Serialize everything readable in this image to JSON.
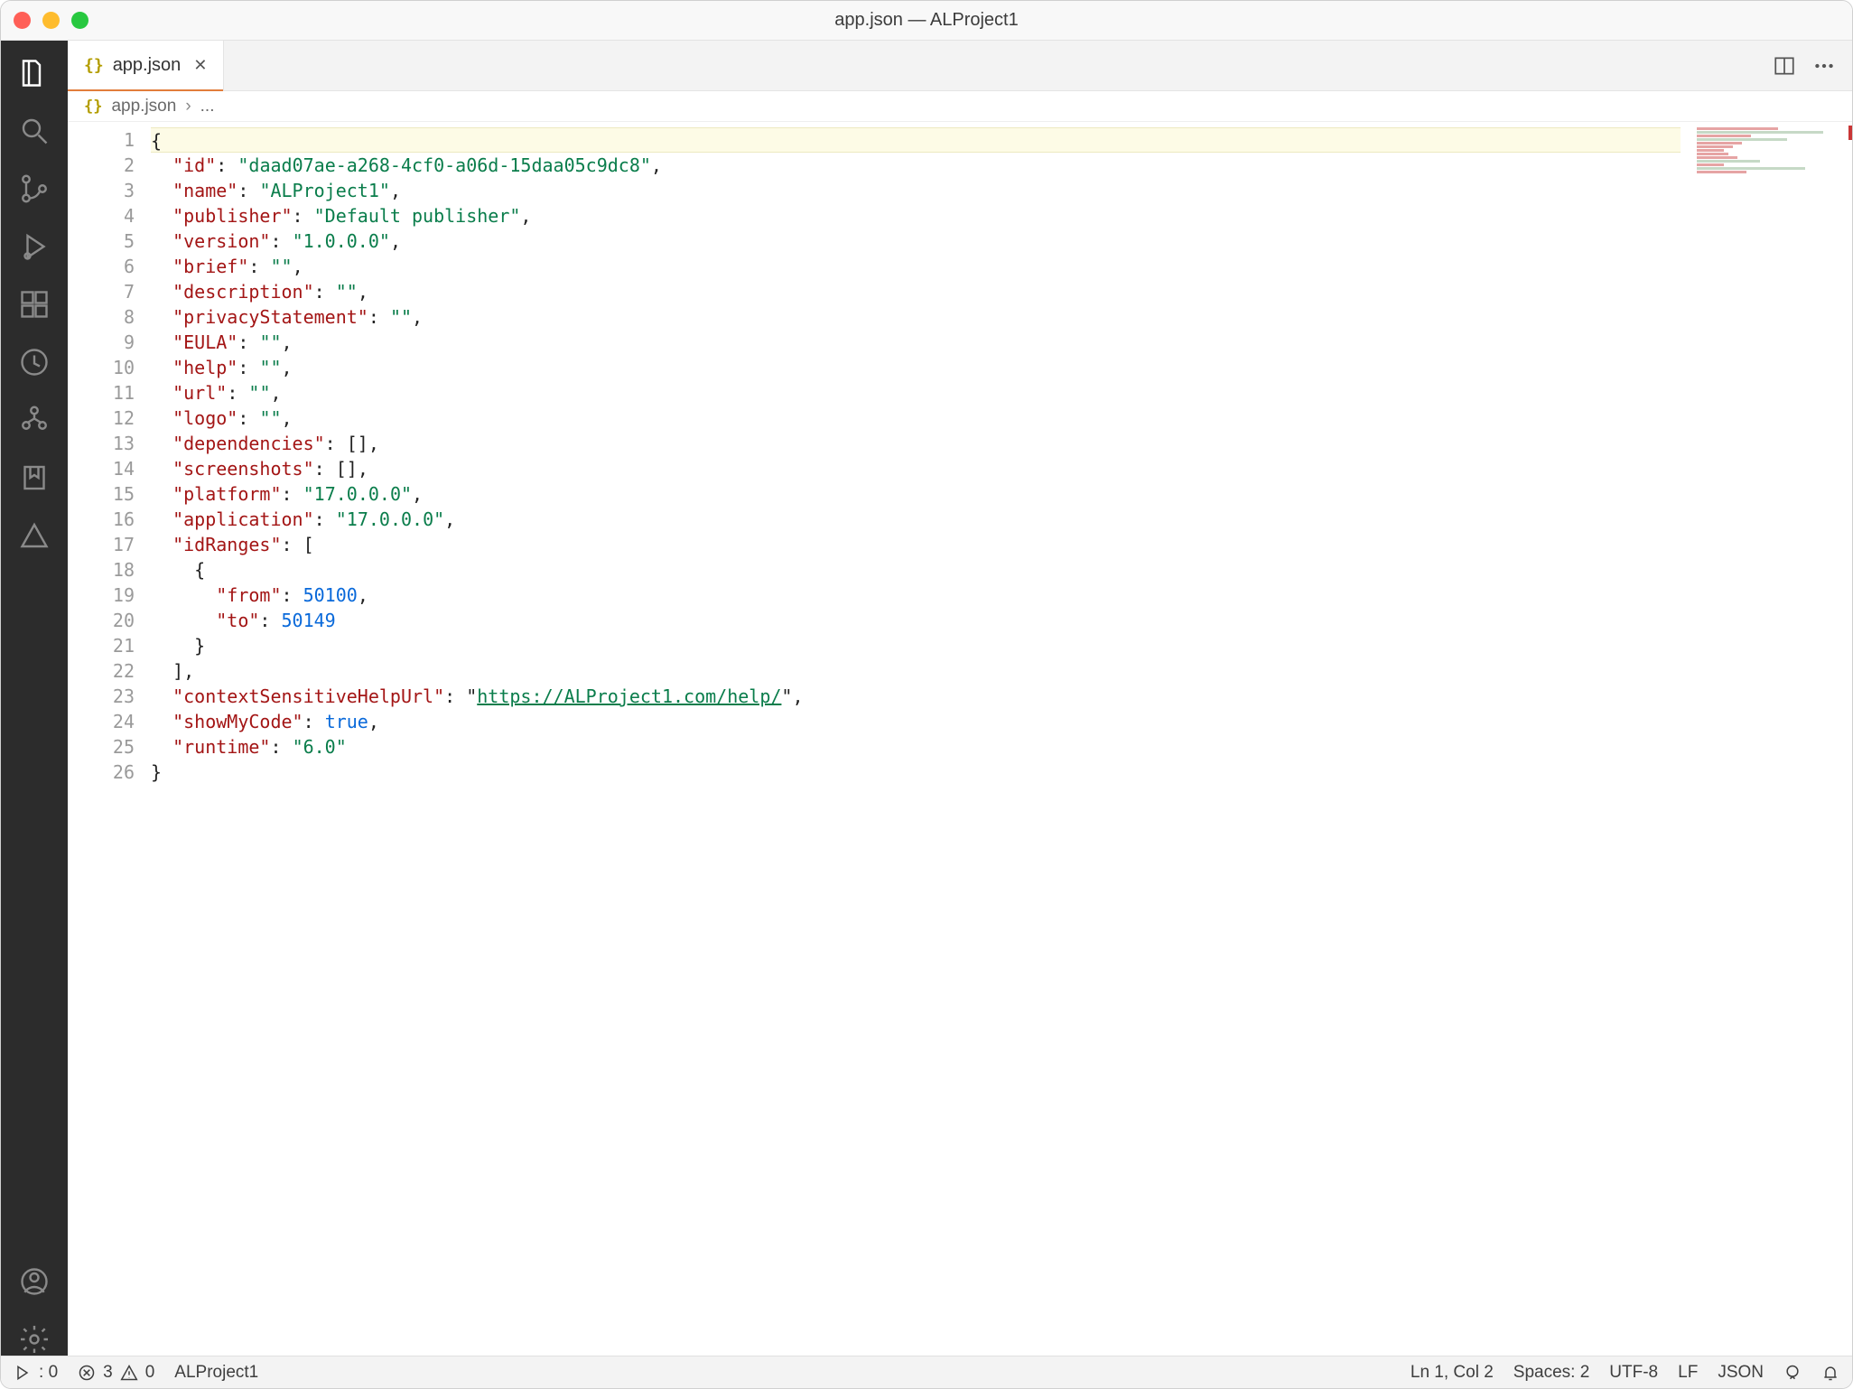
{
  "window": {
    "title": "app.json — ALProject1"
  },
  "tab": {
    "filename": "app.json",
    "icon_label": "{}"
  },
  "breadcrumb": {
    "filename": "app.json",
    "ellipsis": "..."
  },
  "editor_actions": {
    "split_tooltip": "Split Editor",
    "more_tooltip": "More Actions"
  },
  "code_lines": [
    [
      {
        "t": "punc",
        "v": "{"
      }
    ],
    [
      {
        "t": "indent",
        "v": "  "
      },
      {
        "t": "prop",
        "v": "\"id\""
      },
      {
        "t": "punc",
        "v": ": "
      },
      {
        "t": "str",
        "v": "\"daad07ae-a268-4cf0-a06d-15daa05c9dc8\""
      },
      {
        "t": "punc",
        "v": ","
      }
    ],
    [
      {
        "t": "indent",
        "v": "  "
      },
      {
        "t": "prop",
        "v": "\"name\""
      },
      {
        "t": "punc",
        "v": ": "
      },
      {
        "t": "str",
        "v": "\"ALProject1\""
      },
      {
        "t": "punc",
        "v": ","
      }
    ],
    [
      {
        "t": "indent",
        "v": "  "
      },
      {
        "t": "prop",
        "v": "\"publisher\""
      },
      {
        "t": "punc",
        "v": ": "
      },
      {
        "t": "str",
        "v": "\"Default publisher\""
      },
      {
        "t": "punc",
        "v": ","
      }
    ],
    [
      {
        "t": "indent",
        "v": "  "
      },
      {
        "t": "prop",
        "v": "\"version\""
      },
      {
        "t": "punc",
        "v": ": "
      },
      {
        "t": "str",
        "v": "\"1.0.0.0\""
      },
      {
        "t": "punc",
        "v": ","
      }
    ],
    [
      {
        "t": "indent",
        "v": "  "
      },
      {
        "t": "prop",
        "v": "\"brief\""
      },
      {
        "t": "punc",
        "v": ": "
      },
      {
        "t": "str",
        "v": "\"\""
      },
      {
        "t": "punc",
        "v": ","
      }
    ],
    [
      {
        "t": "indent",
        "v": "  "
      },
      {
        "t": "prop",
        "v": "\"description\""
      },
      {
        "t": "punc",
        "v": ": "
      },
      {
        "t": "str",
        "v": "\"\""
      },
      {
        "t": "punc",
        "v": ","
      }
    ],
    [
      {
        "t": "indent",
        "v": "  "
      },
      {
        "t": "prop",
        "v": "\"privacyStatement\""
      },
      {
        "t": "punc",
        "v": ": "
      },
      {
        "t": "str",
        "v": "\"\""
      },
      {
        "t": "punc",
        "v": ","
      }
    ],
    [
      {
        "t": "indent",
        "v": "  "
      },
      {
        "t": "prop",
        "v": "\"EULA\""
      },
      {
        "t": "punc",
        "v": ": "
      },
      {
        "t": "str",
        "v": "\"\""
      },
      {
        "t": "punc",
        "v": ","
      }
    ],
    [
      {
        "t": "indent",
        "v": "  "
      },
      {
        "t": "prop",
        "v": "\"help\""
      },
      {
        "t": "punc",
        "v": ": "
      },
      {
        "t": "str",
        "v": "\"\""
      },
      {
        "t": "punc",
        "v": ","
      }
    ],
    [
      {
        "t": "indent",
        "v": "  "
      },
      {
        "t": "prop",
        "v": "\"url\""
      },
      {
        "t": "punc",
        "v": ": "
      },
      {
        "t": "str",
        "v": "\"\""
      },
      {
        "t": "punc",
        "v": ","
      }
    ],
    [
      {
        "t": "indent",
        "v": "  "
      },
      {
        "t": "prop",
        "v": "\"logo\""
      },
      {
        "t": "punc",
        "v": ": "
      },
      {
        "t": "str",
        "v": "\"\""
      },
      {
        "t": "punc",
        "v": ","
      }
    ],
    [
      {
        "t": "indent",
        "v": "  "
      },
      {
        "t": "prop",
        "v": "\"dependencies\""
      },
      {
        "t": "punc",
        "v": ": []"
      },
      {
        "t": "punc",
        "v": ","
      }
    ],
    [
      {
        "t": "indent",
        "v": "  "
      },
      {
        "t": "prop",
        "v": "\"screenshots\""
      },
      {
        "t": "punc",
        "v": ": []"
      },
      {
        "t": "punc",
        "v": ","
      }
    ],
    [
      {
        "t": "indent",
        "v": "  "
      },
      {
        "t": "prop",
        "v": "\"platform\""
      },
      {
        "t": "punc",
        "v": ": "
      },
      {
        "t": "str",
        "v": "\"17.0.0.0\""
      },
      {
        "t": "punc",
        "v": ","
      }
    ],
    [
      {
        "t": "indent",
        "v": "  "
      },
      {
        "t": "prop",
        "v": "\"application\""
      },
      {
        "t": "punc",
        "v": ": "
      },
      {
        "t": "str",
        "v": "\"17.0.0.0\""
      },
      {
        "t": "punc",
        "v": ","
      }
    ],
    [
      {
        "t": "indent",
        "v": "  "
      },
      {
        "t": "prop",
        "v": "\"idRanges\""
      },
      {
        "t": "punc",
        "v": ": ["
      }
    ],
    [
      {
        "t": "indent",
        "v": "    "
      },
      {
        "t": "punc",
        "v": "{"
      }
    ],
    [
      {
        "t": "indent",
        "v": "      "
      },
      {
        "t": "prop",
        "v": "\"from\""
      },
      {
        "t": "punc",
        "v": ": "
      },
      {
        "t": "num",
        "v": "50100"
      },
      {
        "t": "punc",
        "v": ","
      }
    ],
    [
      {
        "t": "indent",
        "v": "      "
      },
      {
        "t": "prop",
        "v": "\"to\""
      },
      {
        "t": "punc",
        "v": ": "
      },
      {
        "t": "num",
        "v": "50149"
      }
    ],
    [
      {
        "t": "indent",
        "v": "    "
      },
      {
        "t": "punc",
        "v": "}"
      }
    ],
    [
      {
        "t": "indent",
        "v": "  "
      },
      {
        "t": "punc",
        "v": "],"
      }
    ],
    [
      {
        "t": "indent",
        "v": "  "
      },
      {
        "t": "prop",
        "v": "\"contextSensitiveHelpUrl\""
      },
      {
        "t": "punc",
        "v": ": "
      },
      {
        "t": "punc",
        "v": "\""
      },
      {
        "t": "url",
        "v": "https://ALProject1.com/help/"
      },
      {
        "t": "punc",
        "v": "\","
      }
    ],
    [
      {
        "t": "indent",
        "v": "  "
      },
      {
        "t": "prop",
        "v": "\"showMyCode\""
      },
      {
        "t": "punc",
        "v": ": "
      },
      {
        "t": "bool",
        "v": "true"
      },
      {
        "t": "punc",
        "v": ","
      }
    ],
    [
      {
        "t": "indent",
        "v": "  "
      },
      {
        "t": "prop",
        "v": "\"runtime\""
      },
      {
        "t": "punc",
        "v": ": "
      },
      {
        "t": "str",
        "v": "\"6.0\""
      }
    ],
    [
      {
        "t": "punc",
        "v": "}"
      }
    ]
  ],
  "line_count": 26,
  "statusbar": {
    "debug_count": "0",
    "errors": "3",
    "warnings": "0",
    "project": "ALProject1",
    "cursor": "Ln 1, Col 2",
    "spaces": "Spaces: 2",
    "encoding": "UTF-8",
    "eol": "LF",
    "language": "JSON"
  }
}
